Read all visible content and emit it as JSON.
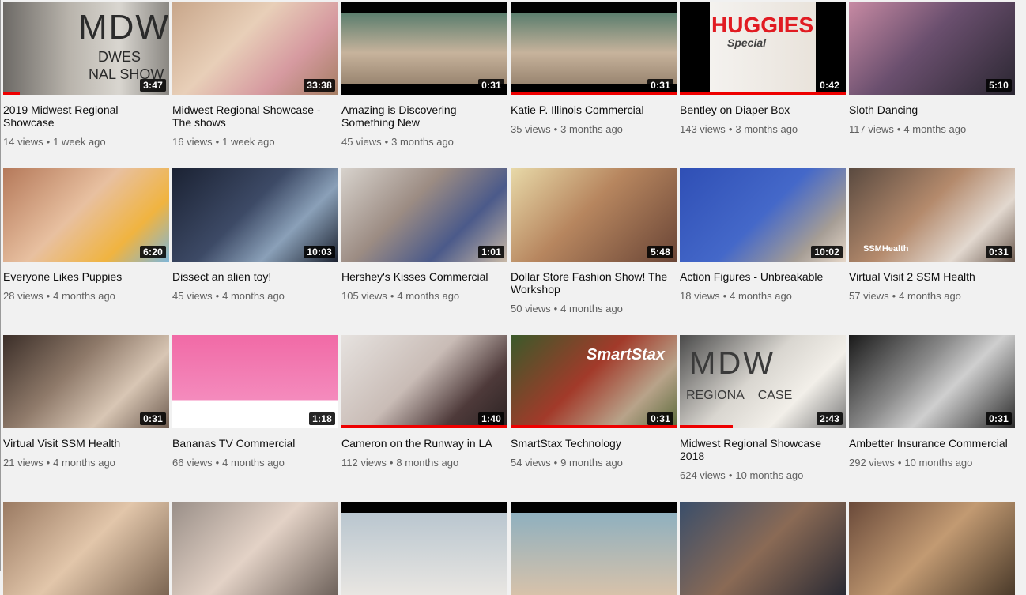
{
  "videos": [
    {
      "title": "2019 Midwest Regional Showcase",
      "views": "14 views",
      "age": "1 week ago",
      "duration": "3:47",
      "progress": 0.1
    },
    {
      "title": "Midwest Regional Showcase - The shows",
      "views": "16 views",
      "age": "1 week ago",
      "duration": "33:38",
      "progress": 0
    },
    {
      "title": "Amazing is Discovering Something New",
      "views": "45 views",
      "age": "3 months ago",
      "duration": "0:31",
      "progress": 0
    },
    {
      "title": "Katie P. Illinois Commercial",
      "views": "35 views",
      "age": "3 months ago",
      "duration": "0:31",
      "progress": 1.0
    },
    {
      "title": "Bentley on Diaper Box",
      "views": "143 views",
      "age": "3 months ago",
      "duration": "0:42",
      "progress": 1.0
    },
    {
      "title": "Sloth Dancing",
      "views": "117 views",
      "age": "4 months ago",
      "duration": "5:10",
      "progress": 0
    },
    {
      "title": "Everyone Likes Puppies",
      "views": "28 views",
      "age": "4 months ago",
      "duration": "6:20",
      "progress": 0
    },
    {
      "title": "Dissect an alien toy!",
      "views": "45 views",
      "age": "4 months ago",
      "duration": "10:03",
      "progress": 0
    },
    {
      "title": "Hershey's Kisses Commercial",
      "views": "105 views",
      "age": "4 months ago",
      "duration": "1:01",
      "progress": 0
    },
    {
      "title": "Dollar Store Fashion Show! The Workshop",
      "views": "50 views",
      "age": "4 months ago",
      "duration": "5:48",
      "progress": 0
    },
    {
      "title": "Action Figures - Unbreakable",
      "views": "18 views",
      "age": "4 months ago",
      "duration": "10:02",
      "progress": 0
    },
    {
      "title": "Virtual Visit 2 SSM Health",
      "views": "57 views",
      "age": "4 months ago",
      "duration": "0:31",
      "progress": 0
    },
    {
      "title": "Virtual Visit SSM Health",
      "views": "21 views",
      "age": "4 months ago",
      "duration": "0:31",
      "progress": 0
    },
    {
      "title": "Bananas TV Commercial",
      "views": "66 views",
      "age": "4 months ago",
      "duration": "1:18",
      "progress": 0
    },
    {
      "title": "Cameron on the Runway in LA",
      "views": "112 views",
      "age": "8 months ago",
      "duration": "1:40",
      "progress": 1.0
    },
    {
      "title": "SmartStax Technology",
      "views": "54 views",
      "age": "9 months ago",
      "duration": "0:31",
      "progress": 1.0
    },
    {
      "title": "Midwest Regional Showcase 2018",
      "views": "624 views",
      "age": "10 months ago",
      "duration": "2:43",
      "progress": 0.32
    },
    {
      "title": "Ambetter Insurance Commercial",
      "views": "292 views",
      "age": "10 months ago",
      "duration": "0:31",
      "progress": 0
    }
  ],
  "partial_row": [
    {},
    {},
    {},
    {},
    {},
    {}
  ],
  "thumb_text": {
    "mdw": "MDW",
    "mdw_sub1": "DWES",
    "mdw_sub2": "NAL SHOW",
    "huggies": "HUGGIES",
    "huggies_sub": "Special",
    "ssm": "SSMHealth",
    "smartstax": "SmartStax",
    "mdw2": "MDW",
    "mdw2_sub": "REGIONA    CASE"
  },
  "colors": {
    "progress": "#ee0000",
    "meta": "#606060",
    "title": "#0d0d0d",
    "bg": "#f1f1f1"
  }
}
